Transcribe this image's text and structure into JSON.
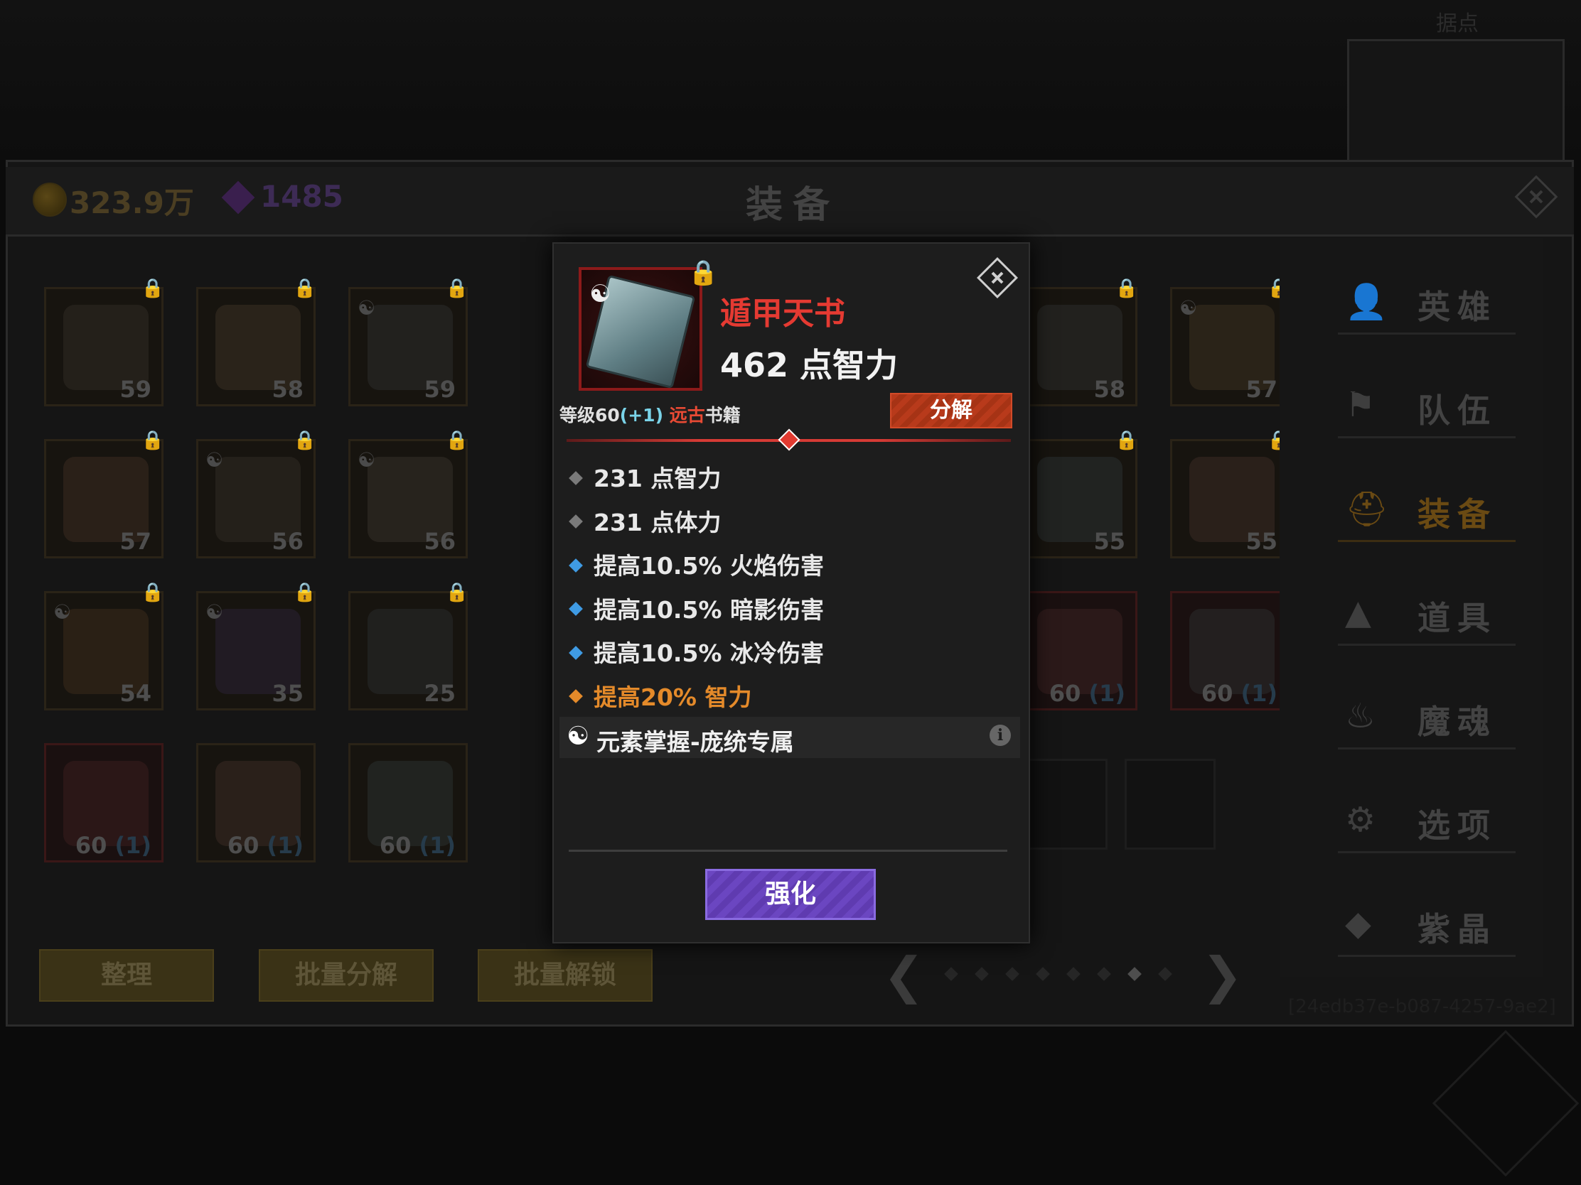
{
  "header": {
    "gold_amount": "323.9万",
    "gem_count": "1485",
    "title": "装备",
    "minimap_title": "据点"
  },
  "grid": {
    "slots": [
      {
        "level": "59",
        "bonus": "",
        "yin": false,
        "lock": true,
        "border": "gold"
      },
      {
        "level": "58",
        "bonus": "",
        "yin": false,
        "lock": true,
        "border": "gold"
      },
      {
        "level": "59",
        "bonus": "",
        "yin": true,
        "lock": true,
        "border": "gold"
      },
      {
        "level": "57",
        "bonus": "",
        "yin": false,
        "lock": true,
        "border": "gold"
      },
      {
        "level": "56",
        "bonus": "",
        "yin": true,
        "lock": true,
        "border": "gold"
      },
      {
        "level": "56",
        "bonus": "",
        "yin": true,
        "lock": true,
        "border": "gold"
      },
      {
        "level": "54",
        "bonus": "",
        "yin": true,
        "lock": true,
        "border": "gold"
      },
      {
        "level": "35",
        "bonus": "",
        "yin": true,
        "lock": true,
        "border": "gold"
      },
      {
        "level": "25",
        "bonus": "",
        "yin": false,
        "lock": true,
        "border": "gold"
      },
      {
        "level": "60",
        "bonus": "(1)",
        "yin": false,
        "lock": false,
        "border": "red"
      },
      {
        "level": "60",
        "bonus": "(1)",
        "yin": false,
        "lock": false,
        "border": "gold"
      },
      {
        "level": "60",
        "bonus": "(1)",
        "yin": false,
        "lock": false,
        "border": "gold"
      },
      {
        "level": "58",
        "bonus": "",
        "yin": false,
        "lock": true,
        "border": "gold"
      },
      {
        "level": "57",
        "bonus": "",
        "yin": true,
        "lock": true,
        "border": "gold"
      },
      {
        "level": "55",
        "bonus": "",
        "yin": false,
        "lock": true,
        "border": "gold"
      },
      {
        "level": "55",
        "bonus": "",
        "yin": false,
        "lock": true,
        "border": "gold"
      },
      {
        "level": "60",
        "bonus": "(1)",
        "yin": false,
        "lock": false,
        "border": "red"
      },
      {
        "level": "60",
        "bonus": "(1)",
        "yin": false,
        "lock": false,
        "border": "red"
      }
    ]
  },
  "bottom_buttons": {
    "sort": "整理",
    "batch_decompose": "批量分解",
    "batch_unlock": "批量解锁"
  },
  "pagination": {
    "total": 8,
    "current": 7
  },
  "guid": "[24edb37e-b087-4257-9ae2]",
  "sidebar": {
    "items": [
      {
        "label": "英雄",
        "icon": "hero-icon"
      },
      {
        "label": "队伍",
        "icon": "flag-icon"
      },
      {
        "label": "装备",
        "icon": "helmet-icon",
        "active": true
      },
      {
        "label": "道具",
        "icon": "bag-icon"
      },
      {
        "label": "魔魂",
        "icon": "flame-icon"
      },
      {
        "label": "选项",
        "icon": "gear-icon"
      },
      {
        "label": "紫晶",
        "icon": "gem-icon"
      }
    ]
  },
  "item": {
    "name": "遁甲天书",
    "main_stat": "462 点智力",
    "level_prefix": "等级60",
    "level_plus": "(+1)",
    "rarity": "远古",
    "category": "书籍",
    "decompose_label": "分解",
    "stats": [
      {
        "text": "231 点智力",
        "type": "basic"
      },
      {
        "text": "231 点体力",
        "type": "basic"
      },
      {
        "text": "提高10.5% 火焰伤害",
        "type": "blue"
      },
      {
        "text": "提高10.5% 暗影伤害",
        "type": "blue"
      },
      {
        "text": "提高10.5% 冰冷伤害",
        "type": "blue"
      },
      {
        "text": "提高20% 智力",
        "type": "orange"
      }
    ],
    "set_text": "元素掌握-庞统专属",
    "info_icon": "i",
    "enhance_label": "强化"
  },
  "colors": {
    "item_name": "#e53a32",
    "rarity": "#e84a34",
    "plus": "#7ad3e8",
    "enhance": "#6b46c1",
    "decompose": "#b83a1b",
    "stat_blue": "#3f9be4",
    "stat_orange": "#e48a2a"
  }
}
